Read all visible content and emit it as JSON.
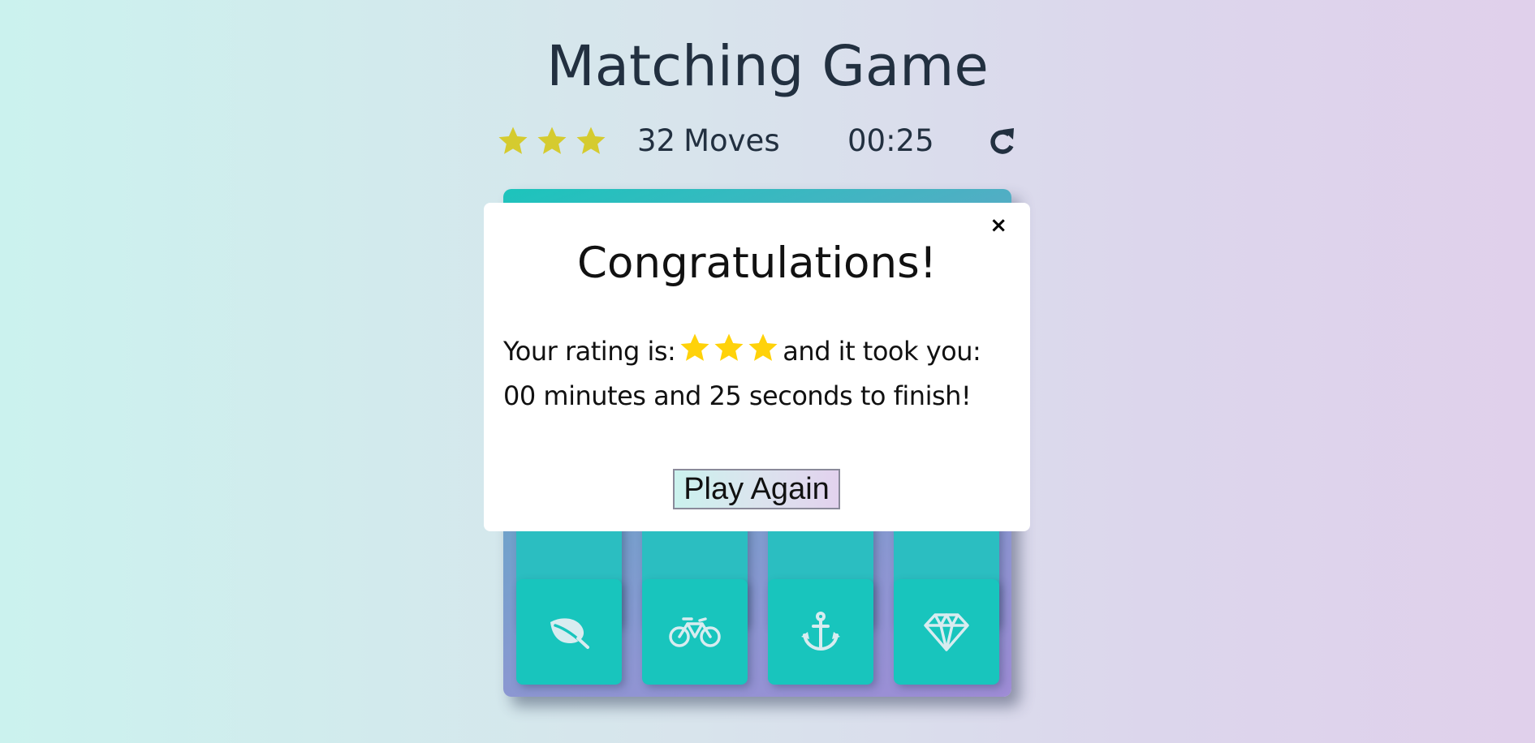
{
  "header": {
    "title": "Matching Game"
  },
  "score_panel": {
    "stars": {
      "count": 3,
      "color": "#d5cb2f"
    },
    "moves_count": "32",
    "moves_label": "Moves",
    "timer": "00:25",
    "restart_icon": "repeat-icon"
  },
  "deck": {
    "card_color": "#18c5bd",
    "visible_cards": [
      {
        "icon": "leaf-icon"
      },
      {
        "icon": "bicycle-icon"
      },
      {
        "icon": "anchor-icon"
      },
      {
        "icon": "diamond-icon"
      }
    ]
  },
  "modal": {
    "title": "Congratulations!",
    "close_label": "×",
    "rating_prefix": "Your rating is:",
    "rating_stars": 3,
    "rating_star_color": "#ffd20a",
    "rating_suffix": "and it took you:",
    "minutes": "00",
    "minutes_label": "minutes and",
    "seconds": "25",
    "seconds_label": "seconds to finish!",
    "button_label": "Play Again"
  }
}
